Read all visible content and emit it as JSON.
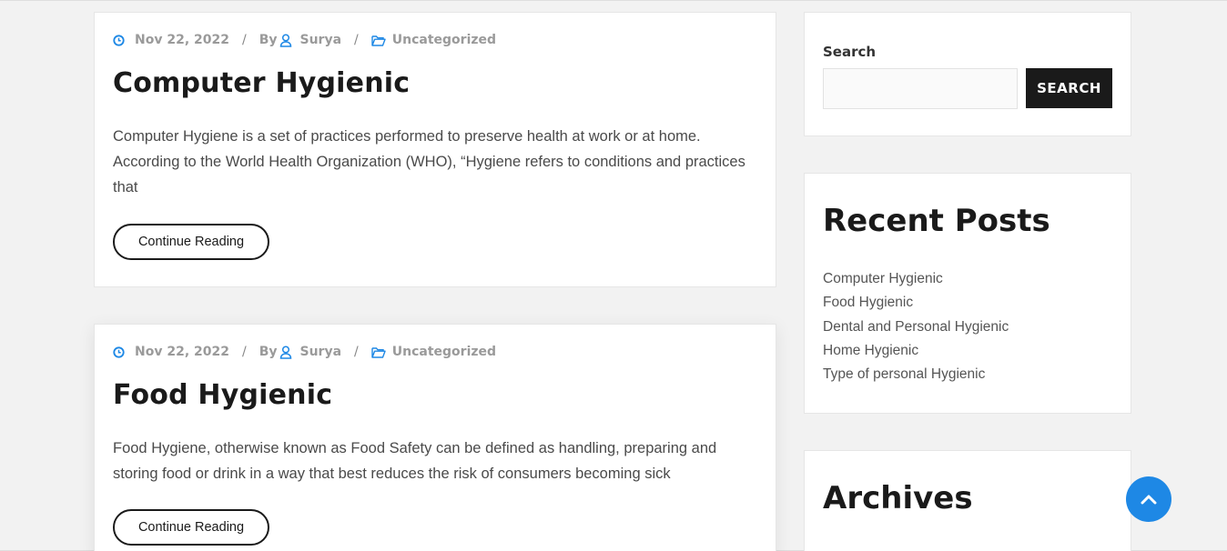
{
  "colors": {
    "accent_blue": "#1e88e5",
    "background": "#f2f2f2",
    "title_text": "#1a1a1a",
    "meta_text": "#9a9a9a"
  },
  "posts": [
    {
      "date": "Nov 22, 2022",
      "by_label": "By",
      "author": "Surya",
      "category": "Uncategorized",
      "separator": "/",
      "title": "Computer Hygienic",
      "excerpt": "Computer Hygiene is a set of practices performed to preserve health at work or at home. According to the World Health Organization (WHO), “Hygiene refers to conditions and practices that",
      "button": "Continue Reading"
    },
    {
      "date": "Nov 22, 2022",
      "by_label": "By",
      "author": "Surya",
      "category": "Uncategorized",
      "separator": "/",
      "title": "Food Hygienic",
      "excerpt": "Food Hygiene, otherwise known as Food Safety can be defined as handling, preparing and storing food or drink in a way that best reduces the risk of consumers becoming sick",
      "button": "Continue Reading"
    }
  ],
  "sidebar": {
    "search": {
      "label": "Search",
      "placeholder": "",
      "value": "",
      "button": "SEARCH"
    },
    "recent_posts": {
      "title": "Recent Posts",
      "items": [
        "Computer Hygienic",
        "Food Hygienic",
        "Dental and Personal Hygienic",
        "Home Hygienic",
        "Type of personal Hygienic"
      ]
    },
    "archives": {
      "title": "Archives"
    }
  },
  "icons": {
    "date": "clock-icon",
    "author": "user-icon",
    "category": "folder-open-icon",
    "scroll_top": "chevron-up-icon"
  }
}
